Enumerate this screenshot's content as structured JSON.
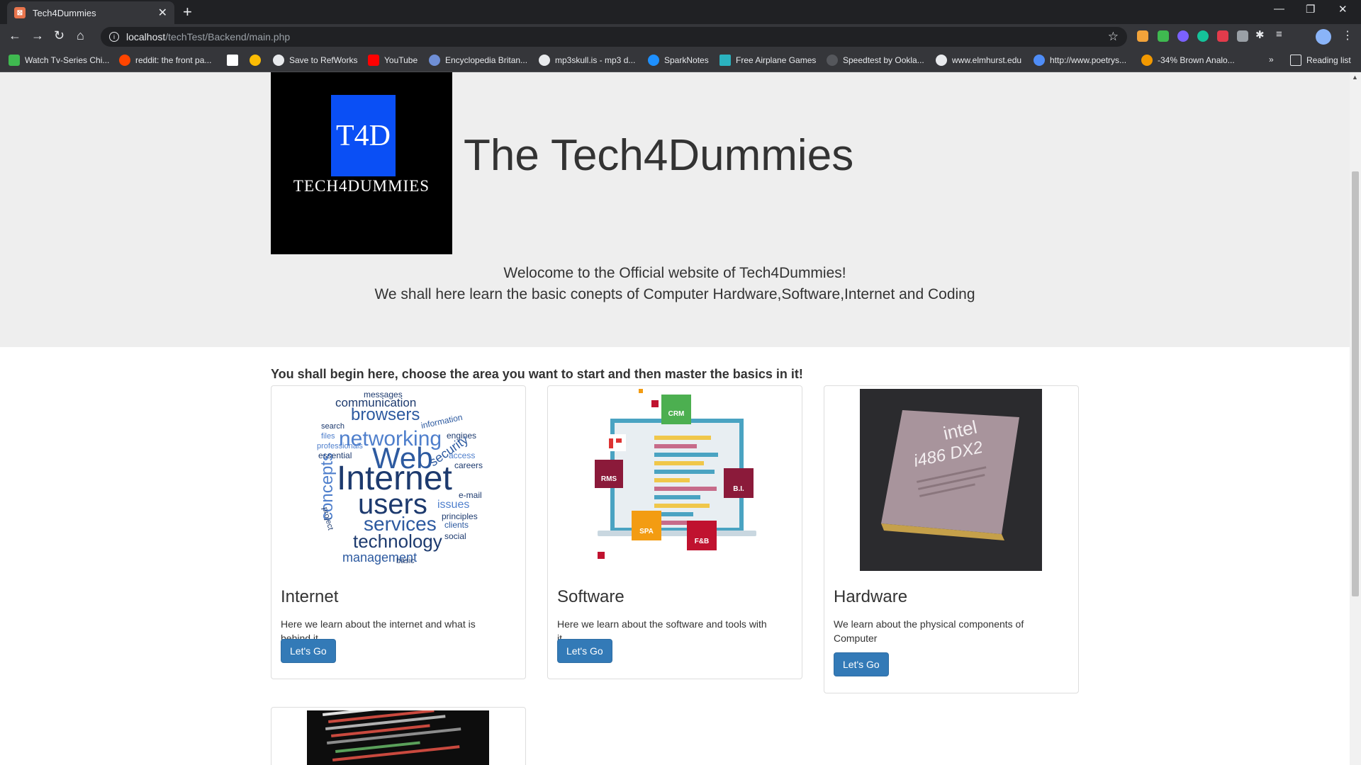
{
  "browser": {
    "tab_title": "Tech4Dummies",
    "url_host": "localhost",
    "url_path": "/techTest/Backend/main.php",
    "bookmarks": [
      "Watch Tv-Series Chi...",
      "reddit: the front pa...",
      "Save to RefWorks",
      "YouTube",
      "Encyclopedia Britan...",
      "mp3skull.is - mp3 d...",
      "SparkNotes",
      "Free Airplane Games",
      "Speedtest by Ookla...",
      "www.elmhurst.edu",
      "http://www.poetrys...",
      "-34% Brown Analo..."
    ],
    "reading_list": "Reading list",
    "overflow": "»"
  },
  "header": {
    "logo_mark": "T4D",
    "logo_word": "TECH4DUMMIES",
    "title": "The Tech4Dummies",
    "welcome_line1": "Welocome to the Official website of Tech4Dummies!",
    "welcome_line2": "We shall here learn the basic conepts of Computer Hardware,Software,Internet and Coding"
  },
  "main": {
    "heading": "You shall begin here, choose the area you want to start and then master the basics in it!",
    "cards": [
      {
        "title": "Internet",
        "text": "Here we learn about the internet and what is behind it",
        "button": "Let's Go"
      },
      {
        "title": "Software",
        "text": "Here we learn about the software and tools with it",
        "button": "Let's Go"
      },
      {
        "title": "Hardware",
        "text": "We learn about the physical components of Computer",
        "button": "Let's Go"
      }
    ],
    "wordcloud": {
      "big": [
        "Internet",
        "Web",
        "users",
        "networking",
        "services",
        "technology",
        "browsers",
        "communication",
        "management",
        "concepts"
      ],
      "small": [
        "messages",
        "information",
        "engines",
        "security",
        "careers",
        "e-mail",
        "issues",
        "principles",
        "clients",
        "social",
        "search",
        "files",
        "professionals",
        "essential",
        "access",
        "basic",
        "project"
      ]
    },
    "software_badges": [
      "CRM",
      "RMS",
      "B.I.",
      "SPA",
      "F&B"
    ],
    "chip": {
      "brand": "intel",
      "model": "i486 DX2"
    },
    "colors": {
      "primary": "#337ab7",
      "jumbotron": "#eeeeee",
      "text": "#333333"
    }
  }
}
